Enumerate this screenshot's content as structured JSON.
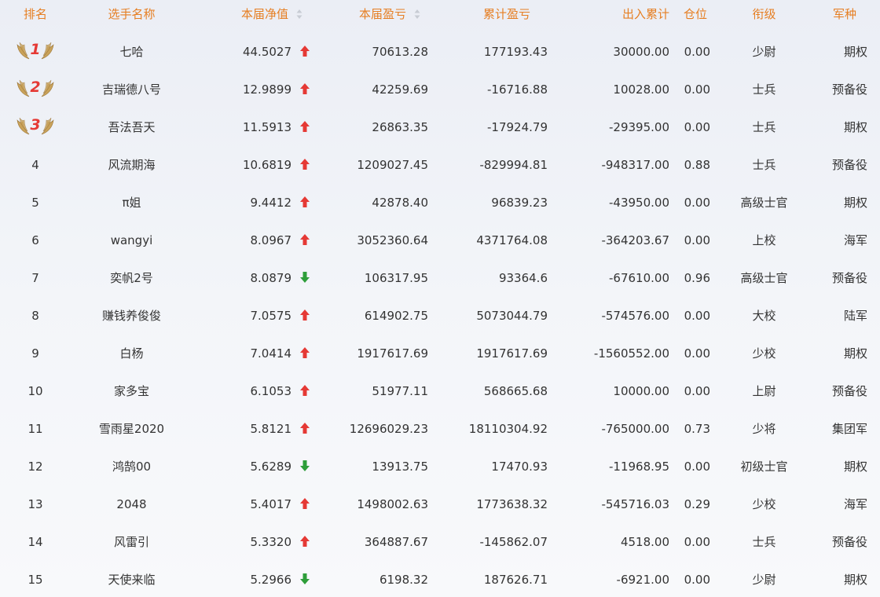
{
  "columns": {
    "rank": "排名",
    "name": "选手名称",
    "nav": "本届净值",
    "cur_pnl": "本届盈亏",
    "cum_pnl": "累计盈亏",
    "cum_io": "出入累计",
    "position": "仓位",
    "title": "衔级",
    "branch": "军种"
  },
  "colors": {
    "header_text": "#e67e22",
    "up": "#e53935",
    "down": "#2e9e3a",
    "medal_number": "#e53935",
    "wing": "#c9a25a"
  },
  "rows": [
    {
      "rank": "1",
      "medal": true,
      "name": "七哈",
      "nav": "44.5027",
      "trend": "up",
      "cur_pnl": "70613.28",
      "cum_pnl": "177193.43",
      "cum_io": "30000.00",
      "position": "0.00",
      "title": "少尉",
      "branch": "期权"
    },
    {
      "rank": "2",
      "medal": true,
      "name": "吉瑞德八号",
      "nav": "12.9899",
      "trend": "up",
      "cur_pnl": "42259.69",
      "cum_pnl": "-16716.88",
      "cum_io": "10028.00",
      "position": "0.00",
      "title": "士兵",
      "branch": "预备役"
    },
    {
      "rank": "3",
      "medal": true,
      "name": "吾法吾天",
      "nav": "11.5913",
      "trend": "up",
      "cur_pnl": "26863.35",
      "cum_pnl": "-17924.79",
      "cum_io": "-29395.00",
      "position": "0.00",
      "title": "士兵",
      "branch": "期权"
    },
    {
      "rank": "4",
      "medal": false,
      "name": "风流期海",
      "nav": "10.6819",
      "trend": "up",
      "cur_pnl": "1209027.45",
      "cum_pnl": "-829994.81",
      "cum_io": "-948317.00",
      "position": "0.88",
      "title": "士兵",
      "branch": "预备役"
    },
    {
      "rank": "5",
      "medal": false,
      "name": "π姐",
      "nav": "9.4412",
      "trend": "up",
      "cur_pnl": "42878.40",
      "cum_pnl": "96839.23",
      "cum_io": "-43950.00",
      "position": "0.00",
      "title": "高级士官",
      "branch": "期权"
    },
    {
      "rank": "6",
      "medal": false,
      "name": "wangyi",
      "nav": "8.0967",
      "trend": "up",
      "cur_pnl": "3052360.64",
      "cum_pnl": "4371764.08",
      "cum_io": "-364203.67",
      "position": "0.00",
      "title": "上校",
      "branch": "海军"
    },
    {
      "rank": "7",
      "medal": false,
      "name": "奕帆2号",
      "nav": "8.0879",
      "trend": "down",
      "cur_pnl": "106317.95",
      "cum_pnl": "93364.6",
      "cum_io": "-67610.00",
      "position": "0.96",
      "title": "高级士官",
      "branch": "预备役"
    },
    {
      "rank": "8",
      "medal": false,
      "name": "赚钱养俊俊",
      "nav": "7.0575",
      "trend": "up",
      "cur_pnl": "614902.75",
      "cum_pnl": "5073044.79",
      "cum_io": "-574576.00",
      "position": "0.00",
      "title": "大校",
      "branch": "陆军"
    },
    {
      "rank": "9",
      "medal": false,
      "name": "白杨",
      "nav": "7.0414",
      "trend": "up",
      "cur_pnl": "1917617.69",
      "cum_pnl": "1917617.69",
      "cum_io": "-1560552.00",
      "position": "0.00",
      "title": "少校",
      "branch": "期权"
    },
    {
      "rank": "10",
      "medal": false,
      "name": "家多宝",
      "nav": "6.1053",
      "trend": "up",
      "cur_pnl": "51977.11",
      "cum_pnl": "568665.68",
      "cum_io": "10000.00",
      "position": "0.00",
      "title": "上尉",
      "branch": "预备役"
    },
    {
      "rank": "11",
      "medal": false,
      "name": "雪雨星2020",
      "nav": "5.8121",
      "trend": "up",
      "cur_pnl": "12696029.23",
      "cum_pnl": "18110304.92",
      "cum_io": "-765000.00",
      "position": "0.73",
      "title": "少将",
      "branch": "集团军"
    },
    {
      "rank": "12",
      "medal": false,
      "name": "鸿鹄00",
      "nav": "5.6289",
      "trend": "down",
      "cur_pnl": "13913.75",
      "cum_pnl": "17470.93",
      "cum_io": "-11968.95",
      "position": "0.00",
      "title": "初级士官",
      "branch": "期权"
    },
    {
      "rank": "13",
      "medal": false,
      "name": "2048",
      "nav": "5.4017",
      "trend": "up",
      "cur_pnl": "1498002.63",
      "cum_pnl": "1773638.32",
      "cum_io": "-545716.03",
      "position": "0.29",
      "title": "少校",
      "branch": "海军"
    },
    {
      "rank": "14",
      "medal": false,
      "name": "风雷引",
      "nav": "5.3320",
      "trend": "up",
      "cur_pnl": "364887.67",
      "cum_pnl": "-145862.07",
      "cum_io": "4518.00",
      "position": "0.00",
      "title": "士兵",
      "branch": "预备役"
    },
    {
      "rank": "15",
      "medal": false,
      "name": "天使来临",
      "nav": "5.2966",
      "trend": "down",
      "cur_pnl": "6198.32",
      "cum_pnl": "187626.71",
      "cum_io": "-6921.00",
      "position": "0.00",
      "title": "少尉",
      "branch": "期权"
    }
  ]
}
